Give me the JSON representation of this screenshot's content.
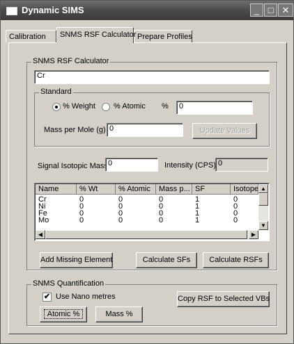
{
  "window": {
    "title": "Dynamic SIMS"
  },
  "tabs": [
    "Calibration",
    "SNMS RSF Calculator",
    "Prepare Profiles"
  ],
  "calculator": {
    "group_label": "SNMS RSF Calculator",
    "element_value": "Cr",
    "standard": {
      "group_label": "Standard",
      "radio_weight": "% Weight",
      "radio_atomic": "% Atomic",
      "selected": "% Weight",
      "percent_label": "%",
      "percent_value": "0",
      "mass_per_mole_label": "Mass per Mole (g)",
      "mass_per_mole_value": "0",
      "update_button": "Update Values"
    },
    "signal_mass_label": "Signal Isotopic Mass",
    "signal_mass_value": "0",
    "intensity_label": "Intensity (CPS)",
    "intensity_value": "0",
    "table": {
      "headers": [
        "Name",
        "% Wt",
        "% Atomic",
        "Mass p...",
        "SF",
        "Isotope"
      ],
      "rows": [
        [
          "Cr",
          "0",
          "0",
          "0",
          "1",
          "0"
        ],
        [
          "Ni",
          "0",
          "0",
          "0",
          "1",
          "0"
        ],
        [
          "Fe",
          "0",
          "0",
          "0",
          "1",
          "0"
        ],
        [
          "Mo",
          "0",
          "0",
          "0",
          "1",
          "0"
        ]
      ]
    },
    "buttons": {
      "add_missing": "Add Missing Element",
      "calc_sfs": "Calculate SFs",
      "calc_rsfs": "Calculate RSFs"
    }
  },
  "quantification": {
    "group_label": "SNMS Quantification",
    "use_nano_label": "Use Nano metres",
    "use_nano_checked": true,
    "copy_button": "Copy RSF to Selected VBs",
    "atomic_button": "Atomic %",
    "mass_button": "Mass %"
  },
  "icons": {
    "minimize": "minimize-icon",
    "maximize": "maximize-icon",
    "close": "close-icon"
  }
}
